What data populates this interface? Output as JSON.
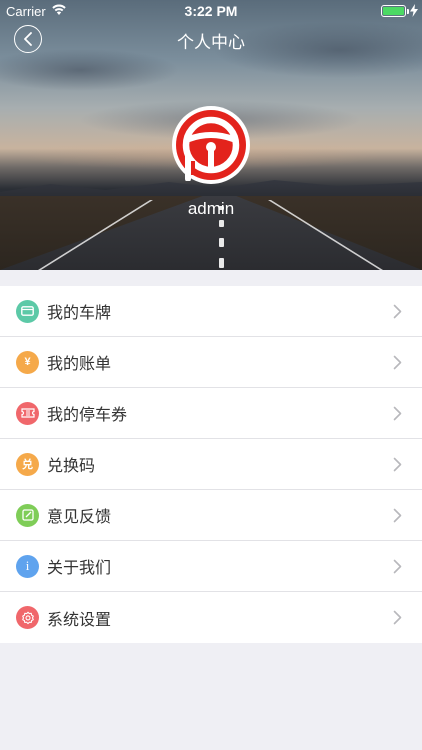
{
  "status_bar": {
    "carrier": "Carrier",
    "time": "3:22 PM"
  },
  "nav": {
    "title": "个人中心",
    "back_icon": "chevron-left-icon"
  },
  "profile": {
    "username": "admin",
    "logo_color": "#e3231c"
  },
  "menu": {
    "items": [
      {
        "label": "我的车牌",
        "icon": "license-plate-icon",
        "color": "#5cc9a7"
      },
      {
        "label": "我的账单",
        "icon": "yen-icon",
        "color": "#f5a94a"
      },
      {
        "label": "我的停车券",
        "icon": "ticket-icon",
        "color": "#f0676b"
      },
      {
        "label": "兑换码",
        "icon": "redeem-icon",
        "color": "#f5a94a"
      },
      {
        "label": "意见反馈",
        "icon": "edit-icon",
        "color": "#7fcd58"
      },
      {
        "label": "关于我们",
        "icon": "info-icon",
        "color": "#5fa3ee"
      },
      {
        "label": "系统设置",
        "icon": "settings-icon",
        "color": "#f0676b"
      }
    ],
    "badge_texts": {
      "yen": "¥",
      "redeem": "兑",
      "info": "i"
    }
  }
}
